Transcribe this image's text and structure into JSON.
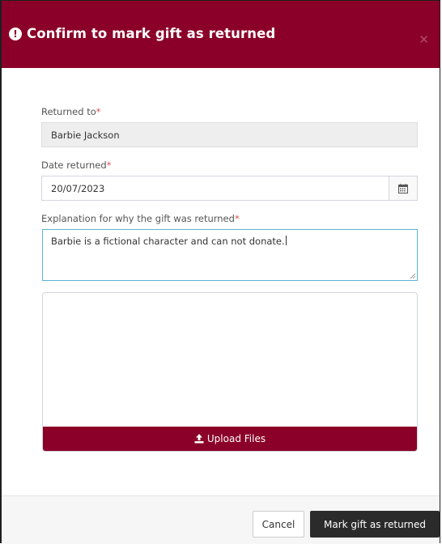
{
  "modal": {
    "title": "Confirm to mark gift as returned",
    "header_icon": "exclamation-circle-icon",
    "close_icon": "close-icon",
    "accent_color": "#8b0028"
  },
  "form": {
    "returned_to": {
      "label": "Returned to",
      "required_mark": "*",
      "value": "Barbie Jackson"
    },
    "date_returned": {
      "label": "Date returned",
      "required_mark": "*",
      "value": "20/07/2023",
      "icon": "calendar-icon"
    },
    "explanation": {
      "label": "Explanation for why the gift was returned",
      "required_mark": "*",
      "value": "Barbie is a fictional character and can not donate."
    },
    "upload": {
      "button_label": "Upload Files",
      "icon": "upload-icon"
    }
  },
  "footer": {
    "cancel_label": "Cancel",
    "submit_label": "Mark gift as returned"
  }
}
